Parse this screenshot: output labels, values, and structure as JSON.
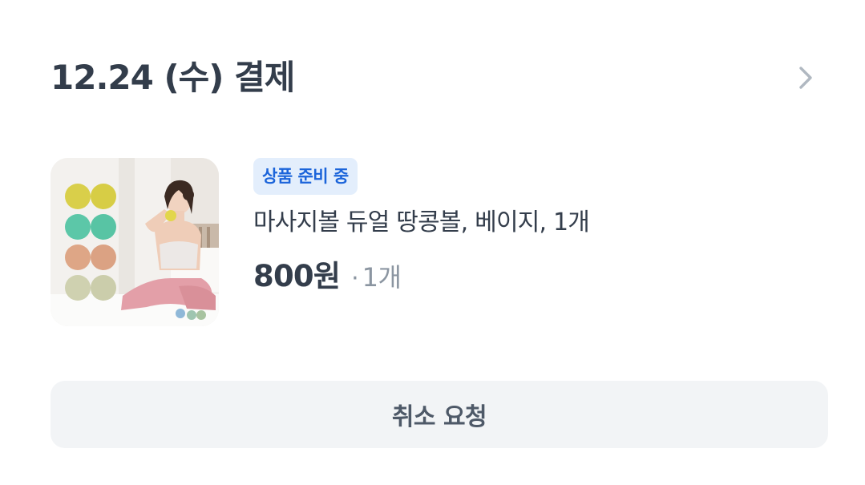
{
  "order": {
    "date_label": "12.24 (수) 결제"
  },
  "icons": {
    "header_chevron": "chevron-right-icon"
  },
  "product": {
    "status_badge": "상품 준비 중",
    "name": "마사지볼 듀얼 땅콩볼, 베이지, 1개",
    "price": "800원",
    "quantity_separator": "·",
    "quantity": "1개"
  },
  "actions": {
    "cancel_label": "취소 요청"
  },
  "colors": {
    "text_primary": "#333d4b",
    "text_secondary": "#8b95a1",
    "badge_bg": "#e3eefc",
    "badge_text": "#1b64da",
    "button_bg": "#f2f4f6",
    "button_text": "#4e5968"
  }
}
